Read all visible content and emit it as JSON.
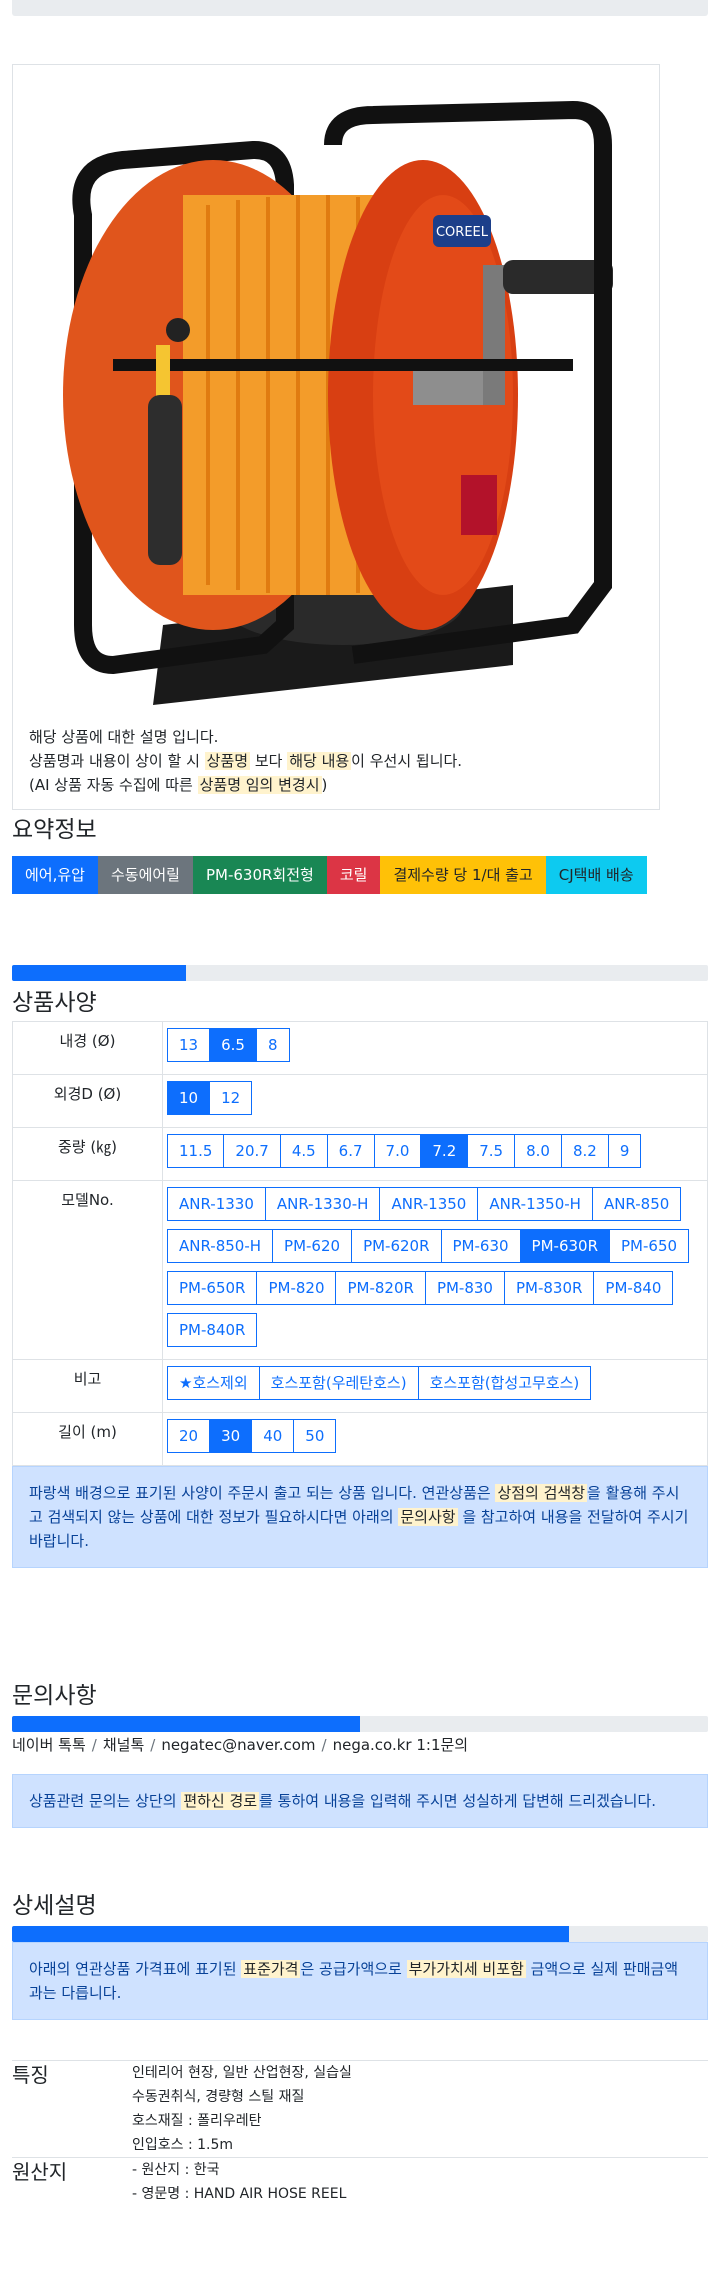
{
  "image_card": {
    "desc_line1": "해당 상품에 대한 설명 입니다.",
    "desc_line2_a": "상품명과 내용이 상이 할 시 ",
    "desc_line2_hl1": "상품명",
    "desc_line2_b": " 보다 ",
    "desc_line2_hl2": "해당 내용",
    "desc_line2_c": "이 우선시 됩니다.",
    "desc_line3_a": "(AI 상품 자동 수집에 따른 ",
    "desc_line3_hl": "상품명 임의 변경시",
    "desc_line3_b": ")",
    "brand_label": "COREEL"
  },
  "summary": {
    "title": "요약정보",
    "badges": [
      {
        "label": "에어,유압",
        "color": "#0d6efd",
        "text": "#ffffff"
      },
      {
        "label": "수동에어릴",
        "color": "#6c757d",
        "text": "#ffffff"
      },
      {
        "label": "PM-630R회전형",
        "color": "#198754",
        "text": "#ffffff"
      },
      {
        "label": "코릴",
        "color": "#dc3545",
        "text": "#ffffff"
      },
      {
        "label": "결제수량 당 1/대 출고",
        "color": "#ffc107",
        "text": "#212529"
      },
      {
        "label": "CJ택배 배송",
        "color": "#0dcaf0",
        "text": "#212529"
      }
    ]
  },
  "spec": {
    "progress": 0.25,
    "title": "상품사양",
    "rows": [
      {
        "label": "내경 (Ø)",
        "options": [
          "13",
          "6.5",
          "8"
        ],
        "selected": 1
      },
      {
        "label": "외경D (Ø)",
        "options": [
          "10",
          "12"
        ],
        "selected": 0
      },
      {
        "label": "중량 (㎏)",
        "options": [
          "11.5",
          "20.7",
          "4.5",
          "6.7",
          "7.0",
          "7.2",
          "7.5",
          "8.0",
          "8.2",
          "9"
        ],
        "selected": 5
      },
      {
        "label": "모델No.",
        "options": [
          "ANR-1330",
          "ANR-1330-H",
          "ANR-1350",
          "ANR-1350-H",
          "ANR-850",
          "ANR-850-H",
          "PM-620",
          "PM-620R",
          "PM-630",
          "PM-630R",
          "PM-650",
          "PM-650R",
          "PM-820",
          "PM-820R",
          "PM-830",
          "PM-830R",
          "PM-840",
          "PM-840R"
        ],
        "selected": 9
      },
      {
        "label": "비고",
        "options": [
          "★호스제외",
          "호스포함(우레탄호스)",
          "호스포함(합성고무호스)"
        ],
        "selected": -1
      },
      {
        "label": "길이 (m)",
        "options": [
          "20",
          "30",
          "40",
          "50"
        ],
        "selected": 1
      }
    ],
    "notice_a": "파랑색 배경으로 표기된 사양이 주문시 출고 되는 상품 입니다. 연관상품은 ",
    "notice_hl1": "상점의 검색창",
    "notice_b": "을 활용해 주시고 검색되지 않는 상품에 대한 정보가 필요하시다면 아래의 ",
    "notice_hl2": "문의사항",
    "notice_c": " 을 참고하여 내용을 전달하여 주시기 바랍니다."
  },
  "inquiry": {
    "title": "문의사항",
    "progress": 0.5,
    "links": [
      "네이버 톡톡",
      "채널톡",
      "negatec@naver.com",
      "nega.co.kr 1:1문의"
    ],
    "notice_a": "상품관련 문의는 상단의 ",
    "notice_hl": "편하신 경로",
    "notice_b": "를 통하여 내용을 입력해 주시면 성실하게 답변해 드리겠습니다."
  },
  "detail": {
    "title": "상세설명",
    "progress": 0.8,
    "notice_a": "아래의 연관상품 가격표에 표기된 ",
    "notice_hl1": "표준가격",
    "notice_b": "은 공급가액으로 ",
    "notice_hl2": "부가가치세 비포함",
    "notice_c": " 금액으로 실제 판매금액과는 다릅니다.",
    "features_label": "특징",
    "features": [
      "인테리어 현장, 일반 산업현장, 실습실",
      "수동권취식, 경량형 스틸 재질",
      "호스재질 : 폴리우레탄",
      "인입호스 : 1.5m"
    ],
    "origin_label": "원산지",
    "origin": [
      "- 원산지 : 한국",
      "- 영문명 : HAND AIR HOSE REEL"
    ]
  }
}
